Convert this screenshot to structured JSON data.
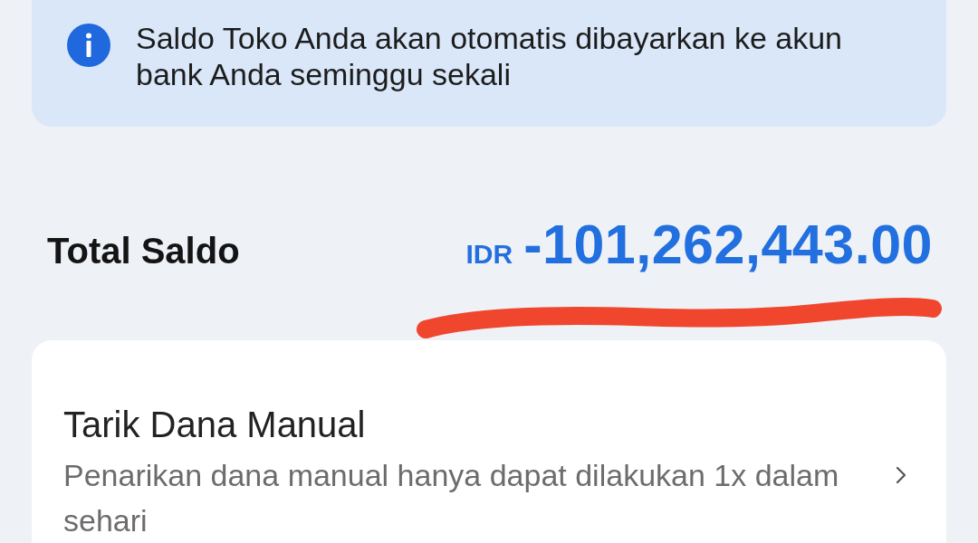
{
  "info_banner": {
    "text": "Saldo Toko Anda akan otomatis dibayarkan ke akun bank Anda seminggu sekali"
  },
  "balance": {
    "label": "Total Saldo",
    "currency": "IDR",
    "amount": "-101,262,443.00"
  },
  "annotations": [
    {
      "kind": "underline"
    }
  ],
  "menu_items": [
    {
      "title": "Tarik Dana Manual",
      "description": "Penarikan dana manual hanya dapat dilakukan 1x dalam sehari"
    }
  ]
}
